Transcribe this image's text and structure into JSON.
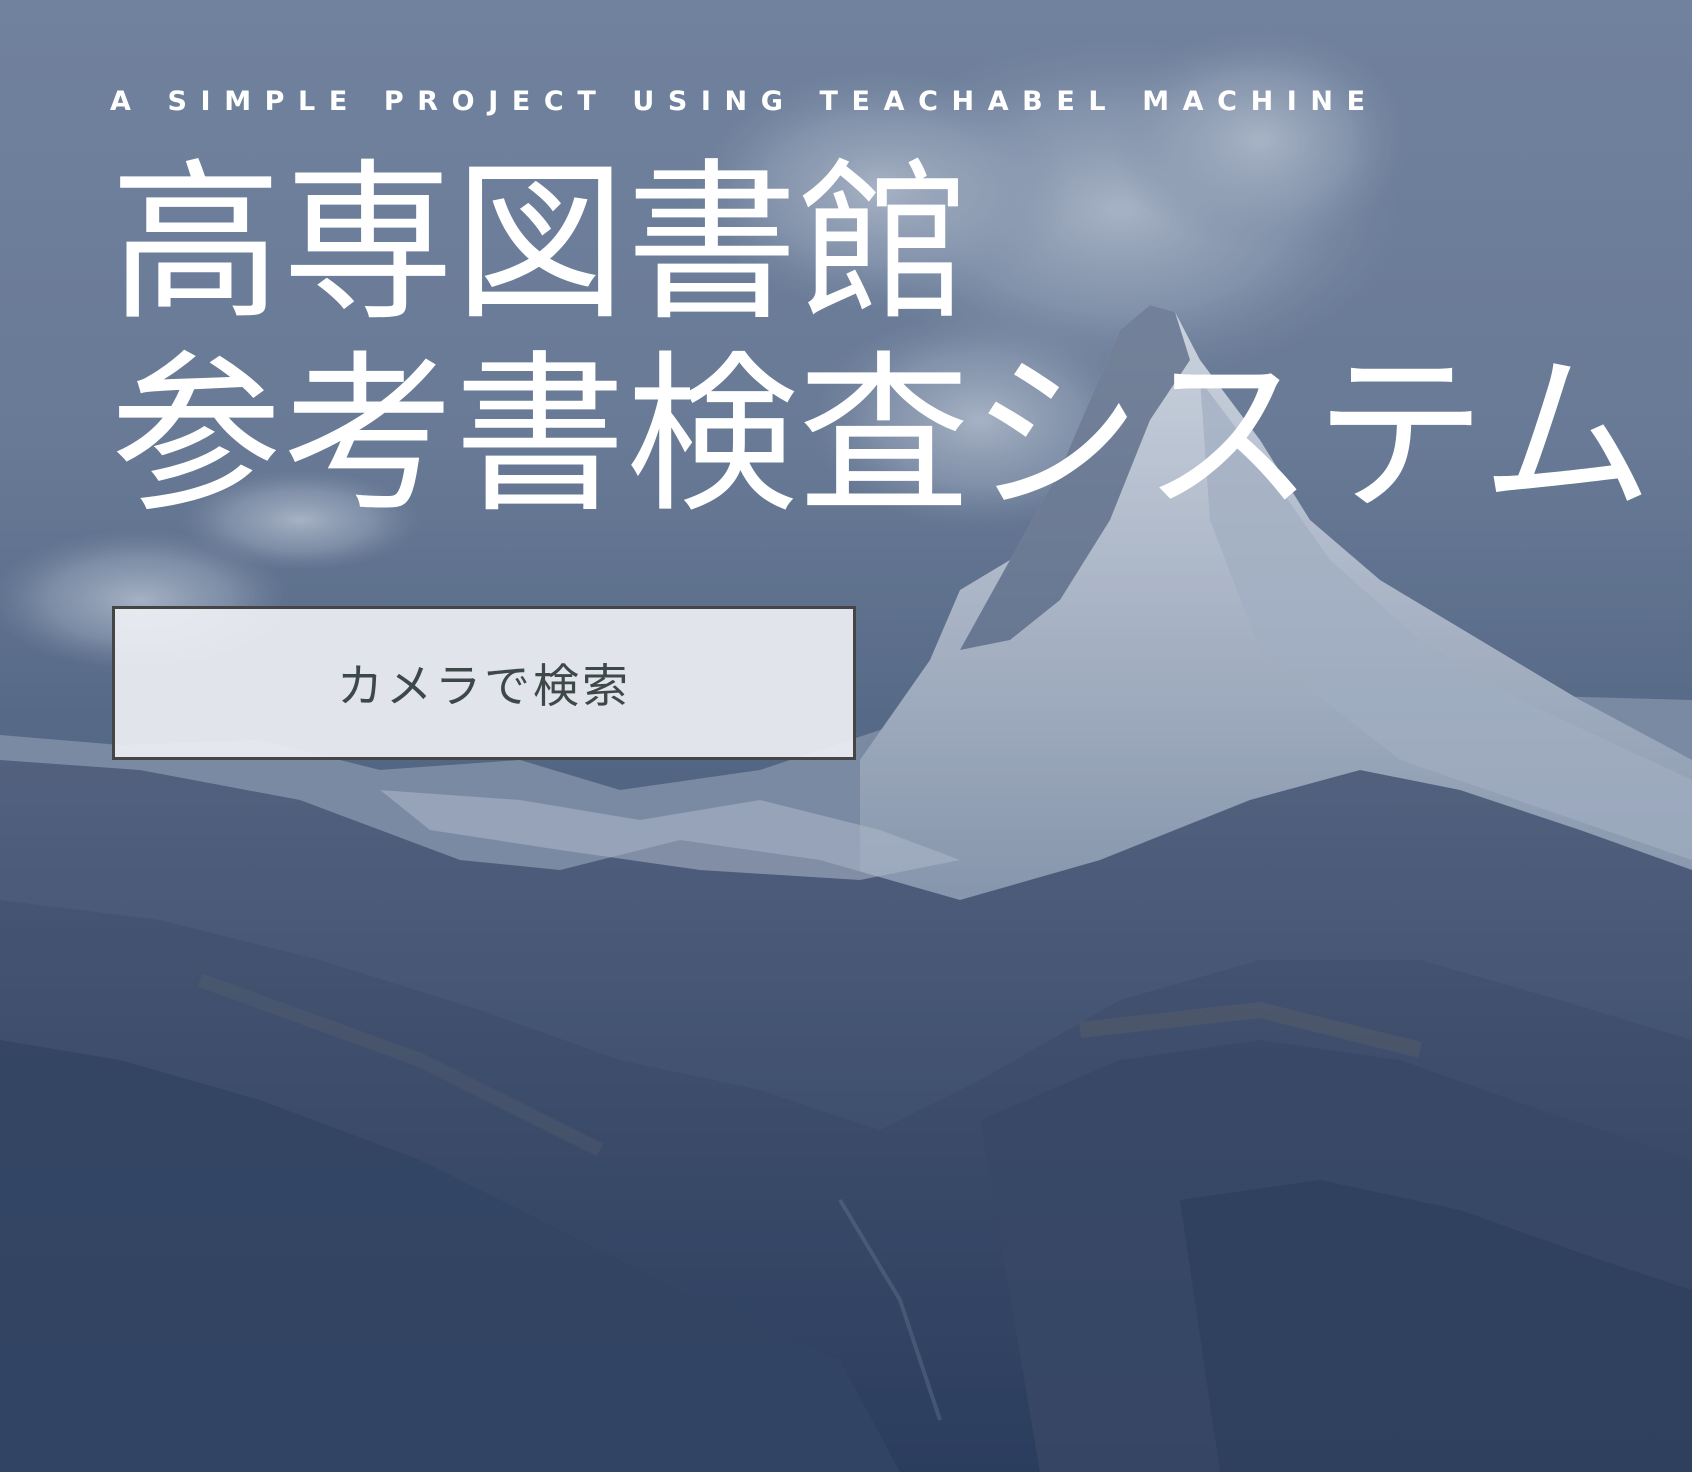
{
  "hero": {
    "subtitle": "A SIMPLE PROJECT USING TEACHABEL MACHINE",
    "title_line1": "高専図書館",
    "title_line2": "参考書検査システム",
    "button_label": "カメラで検索",
    "overlay_color": "#344c78",
    "text_color": "#ffffff"
  }
}
